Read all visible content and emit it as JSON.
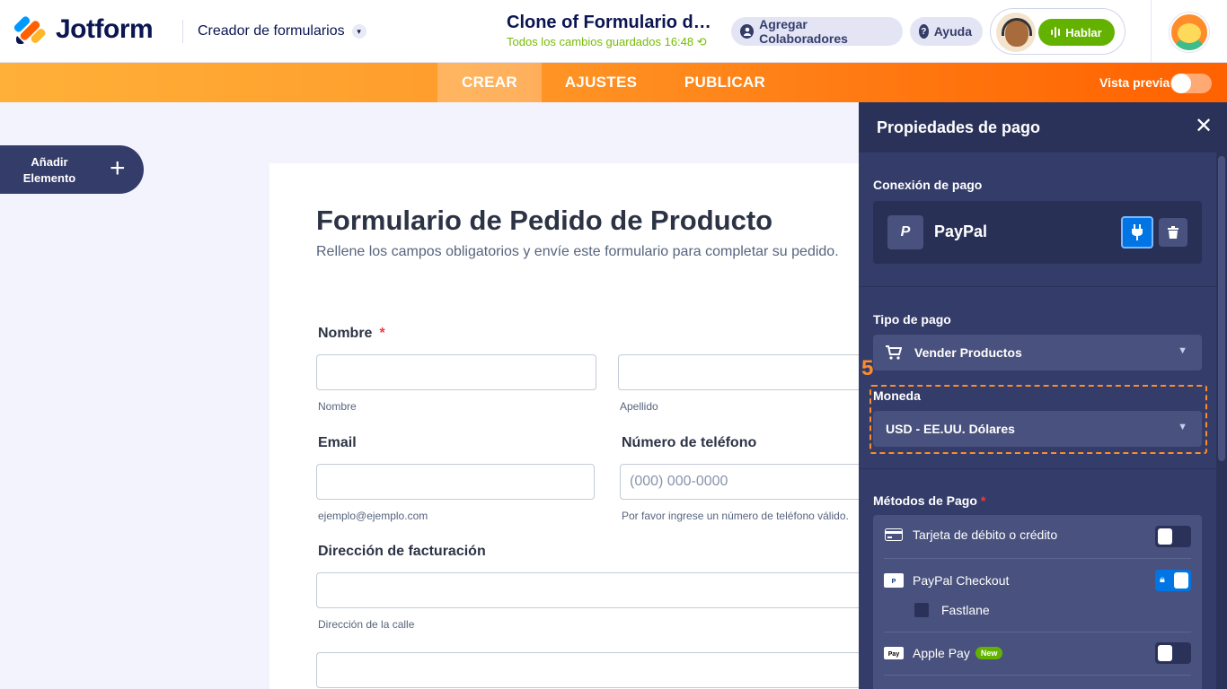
{
  "header": {
    "brand": "Jotform",
    "builder_label": "Creador de formularios",
    "form_title": "Clone of Formulario de Pedido de Producto",
    "save_status": "Todos los cambios guardados 16:48 ⟲",
    "collab_label": "Agregar Colaboradores",
    "help_label": "Ayuda",
    "talk_label": "Hablar"
  },
  "nav": {
    "tabs": [
      "CREAR",
      "AJUSTES",
      "PUBLICAR"
    ],
    "preview_label": "Vista previa"
  },
  "add_element": {
    "label_line1": "Añadir",
    "label_line2": "Elemento",
    "plus": "+"
  },
  "form": {
    "title": "Formulario de Pedido de Producto",
    "subtitle": "Rellene los campos obligatorios y envíe este formulario para completar su pedido.",
    "name_label": "Nombre",
    "required_mark": "*",
    "first_help": "Nombre",
    "last_help": "Apellido",
    "email_label": "Email",
    "email_help": "ejemplo@ejemplo.com",
    "phone_label": "Número de teléfono",
    "phone_placeholder": "(000) 000-0000",
    "phone_help": "Por favor ingrese un número de teléfono válido.",
    "billing_label": "Dirección de facturación",
    "street_help": "Dirección de la calle"
  },
  "panel": {
    "title": "Propiedades de pago",
    "close": "✕",
    "connection_label": "Conexión de pago",
    "gateway_name": "PayPal",
    "gateway_icon_text": "P",
    "payment_type_label": "Tipo de pago",
    "payment_type_value": "Vender Productos",
    "step_number": "5",
    "currency_label": "Moneda",
    "currency_value": "USD - EE.UU. Dólares",
    "methods_label": "Métodos de Pago",
    "methods_required": "*",
    "methods": {
      "card": "Tarjeta de débito o crédito",
      "paypal_checkout": "PayPal Checkout",
      "fastlane": "Fastlane",
      "apple_pay": "Apple Pay",
      "new_badge": "New"
    }
  }
}
